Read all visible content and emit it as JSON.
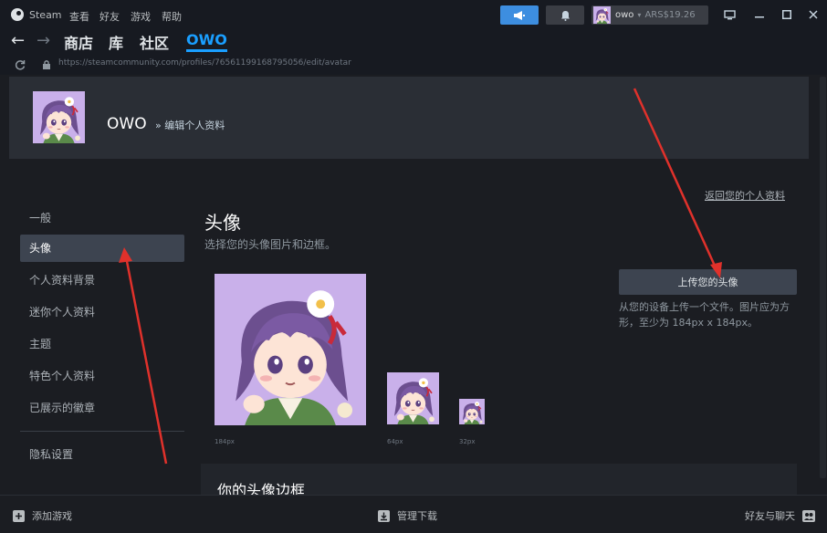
{
  "menubar": {
    "steam": "Steam",
    "view": "查看",
    "friends": "好友",
    "games": "游戏",
    "help": "帮助"
  },
  "account": {
    "name": "owo",
    "balance": "ARS$19.26"
  },
  "nav": {
    "store": "商店",
    "library": "库",
    "community": "社区",
    "profile": "OWO"
  },
  "url": "https://steamcommunity.com/profiles/76561199168795056/edit/avatar",
  "header": {
    "name": "OWO",
    "subtitle": "» 编辑个人资料"
  },
  "back_link": "返回您的个人资料",
  "sidebar": {
    "items": [
      {
        "label": "一般"
      },
      {
        "label": "头像"
      },
      {
        "label": "个人资料背景"
      },
      {
        "label": "迷你个人资料"
      },
      {
        "label": "主题"
      },
      {
        "label": "特色个人资料"
      },
      {
        "label": "已展示的徽章"
      }
    ],
    "privacy": "隐私设置"
  },
  "avatar_section": {
    "title": "头像",
    "description": "选择您的头像图片和边框。",
    "size_large": "184px",
    "size_medium": "64px",
    "size_small": "32px"
  },
  "upload": {
    "button": "上传您的头像",
    "hint": "从您的设备上传一个文件。图片应为方形，至少为 184px x 184px。"
  },
  "frame_section": {
    "title": "你的头像边框"
  },
  "bottombar": {
    "add_game": "添加游戏",
    "manage_downloads": "管理下载",
    "friends_chat": "好友与聊天"
  },
  "colors": {
    "accent": "#1a9fff",
    "annotation": "#e0312b"
  }
}
